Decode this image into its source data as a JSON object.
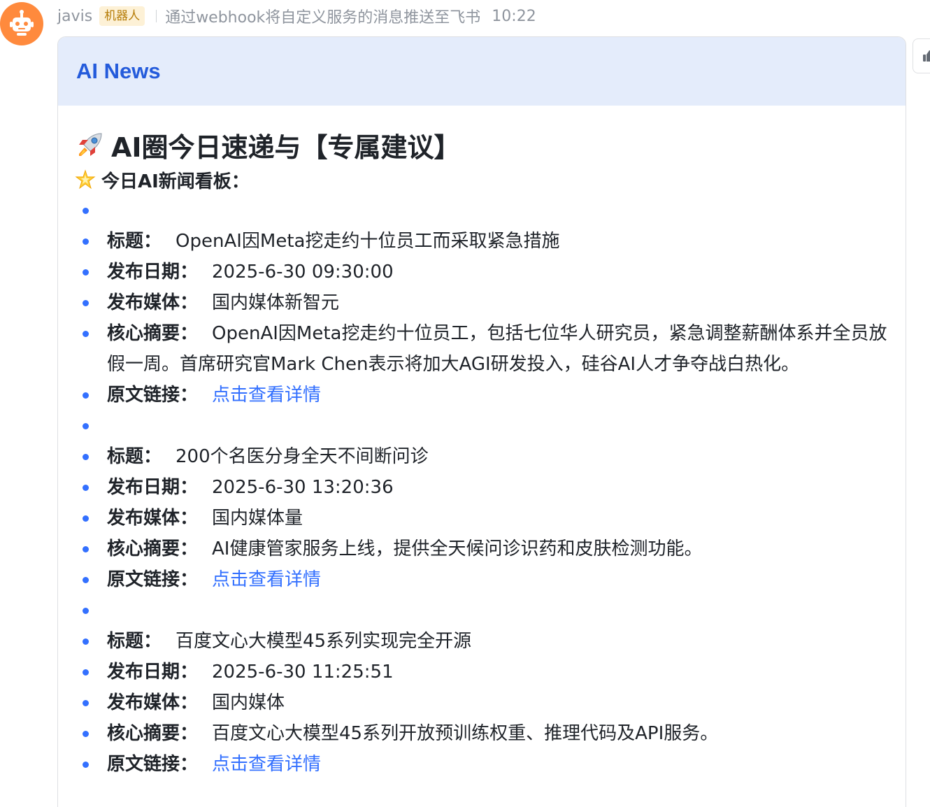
{
  "message": {
    "sender": "javis",
    "bot_badge": "机器人",
    "subtitle": "通过webhook将自定义服务的消息推送至飞书",
    "time": "10:22"
  },
  "card": {
    "title": "AI News",
    "heading": "AI圈今日速递与【专属建议】",
    "subheading": "今日AI新闻看板："
  },
  "labels": {
    "title": "标题：",
    "date": "发布日期：",
    "media": "发布媒体：",
    "summary": "核心摘要：",
    "link": "原文链接："
  },
  "news": [
    {
      "title": "OpenAI因Meta挖走约十位员工而采取紧急措施",
      "date": "2025-6-30 09:30:00",
      "media": "国内媒体新智元",
      "summary": "OpenAI因Meta挖走约十位员工，包括七位华人研究员，紧急调整薪酬体系并全员放假一周。首席研究官Mark Chen表示将加大AGI研发投入，硅谷AI人才争夺战白热化。",
      "link_text": "点击查看详情"
    },
    {
      "title": "200个名医分身全天不间断问诊",
      "date": "2025-6-30 13:20:36",
      "media": "国内媒体量",
      "summary": "AI健康管家服务上线，提供全天候问诊识药和皮肤检测功能。",
      "link_text": "点击查看详情"
    },
    {
      "title": "百度文心大模型45系列实现完全开源",
      "date": "2025-6-30 11:25:51",
      "media": "国内媒体",
      "summary": "百度文心大模型45系列开放预训练权重、推理代码及API服务。",
      "link_text": "点击查看详情"
    }
  ],
  "icons": {
    "avatar": "robot-icon",
    "heading": "rocket-icon",
    "subheading": "sparkle-star-icon",
    "side": "thumbs-up-icon"
  },
  "colors": {
    "accent": "#3370ff",
    "card_header_bg": "#e4ecfb",
    "card_title": "#245bdb",
    "avatar_bg": "#ff8a3d",
    "badge_bg": "#fdf1d6",
    "badge_text": "#b67d08"
  }
}
